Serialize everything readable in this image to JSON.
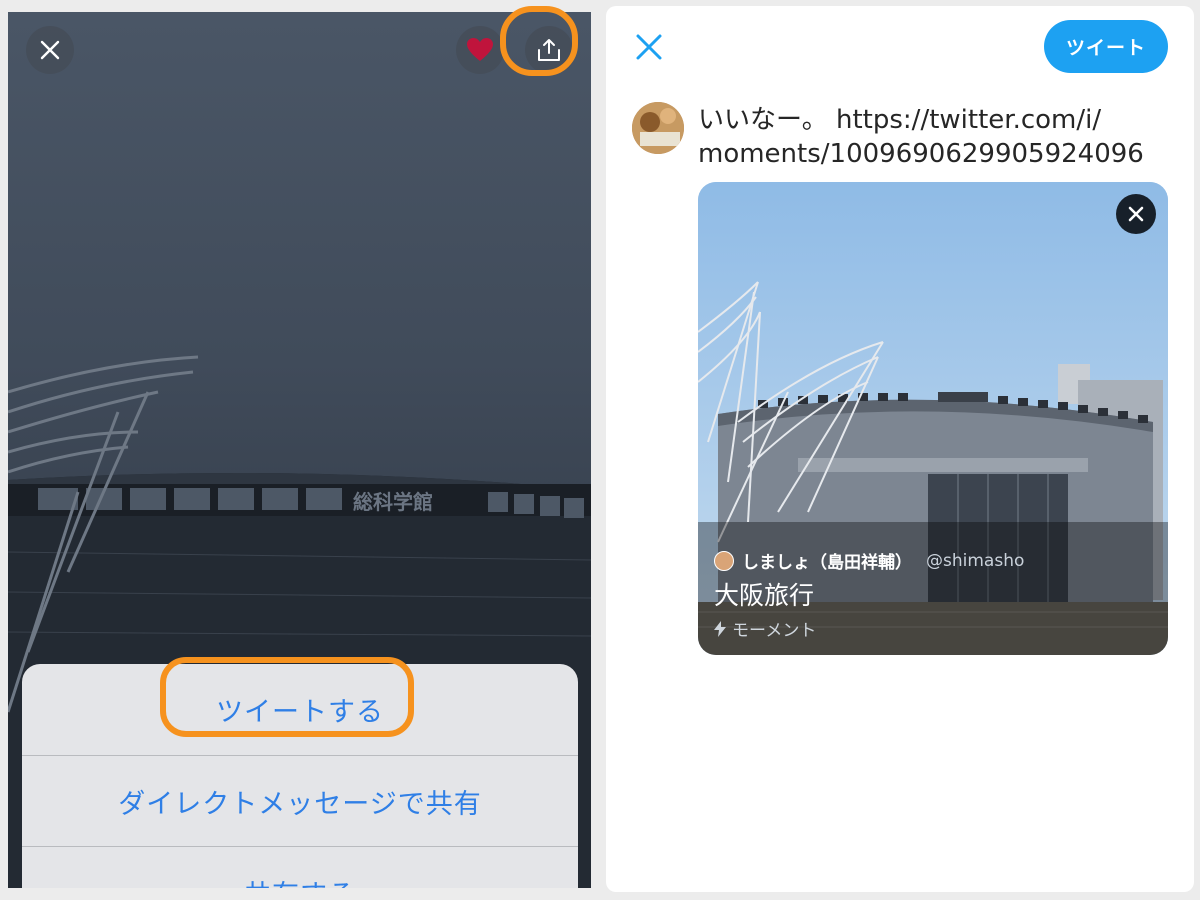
{
  "left_panel": {
    "action_sheet": {
      "tweet_label": "ツイートする",
      "dm_label": "ダイレクトメッセージで共有",
      "share_label": "共有する"
    },
    "building_sign": "総科学館"
  },
  "compose": {
    "tweet_button_label": "ツイート",
    "text_line1": "いいなー。 https://twitter.com/i/",
    "text_line2": "moments/1009690629905924096",
    "card": {
      "author_name": "しましょ（島田祥輔）",
      "author_handle": "@shimasho",
      "title": "大阪旅行",
      "type_label": "モーメント"
    }
  },
  "colors": {
    "highlight": "#f6921e",
    "twitter_blue": "#1da1f2",
    "ios_blue": "#2f7fe6",
    "like_red": "#c0143c"
  },
  "icons": [
    "close-icon",
    "heart-icon",
    "share-icon",
    "lightning-icon"
  ]
}
